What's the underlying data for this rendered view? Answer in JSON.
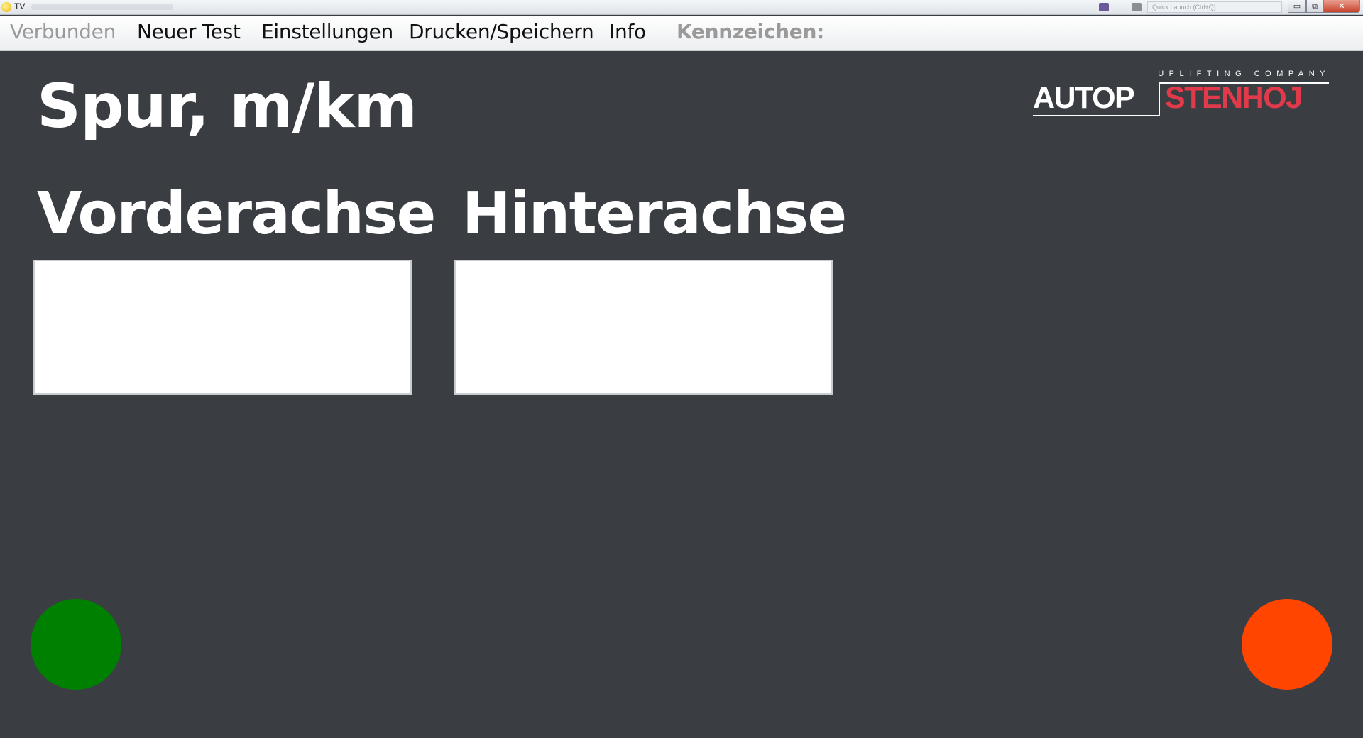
{
  "window": {
    "title": "TV",
    "search_placeholder": "Quick Launch (Ctrl+Q)",
    "buttons": {
      "minimize": "▭",
      "restore": "⧉",
      "close": "✕"
    }
  },
  "menu": {
    "items": [
      {
        "label": "Verbunden",
        "enabled": false
      },
      {
        "label": "Neuer Test",
        "enabled": true
      },
      {
        "label": "Einstellungen",
        "enabled": true
      },
      {
        "label": "Drucken/Speichern",
        "enabled": true
      },
      {
        "label": "Info",
        "enabled": true
      }
    ],
    "plate_label": "Kennzeichen:"
  },
  "main": {
    "title": "Spur, m/km",
    "front_axle": {
      "label": "Vorderachse",
      "value": ""
    },
    "rear_axle": {
      "label": "Hinterachse",
      "value": ""
    }
  },
  "logo": {
    "tagline": "UPLIFTING COMPANY",
    "left_word": "AUTOP",
    "right_word": "STENHOJ",
    "left_color": "#ffffff",
    "right_color": "#e03a4b"
  },
  "indicators": {
    "left": {
      "icon": "status-light",
      "color": "#008000"
    },
    "right": {
      "icon": "status-light",
      "color": "#ff4500"
    }
  },
  "colors": {
    "background": "#3a3e43",
    "menubar": "#f2f3f4"
  }
}
